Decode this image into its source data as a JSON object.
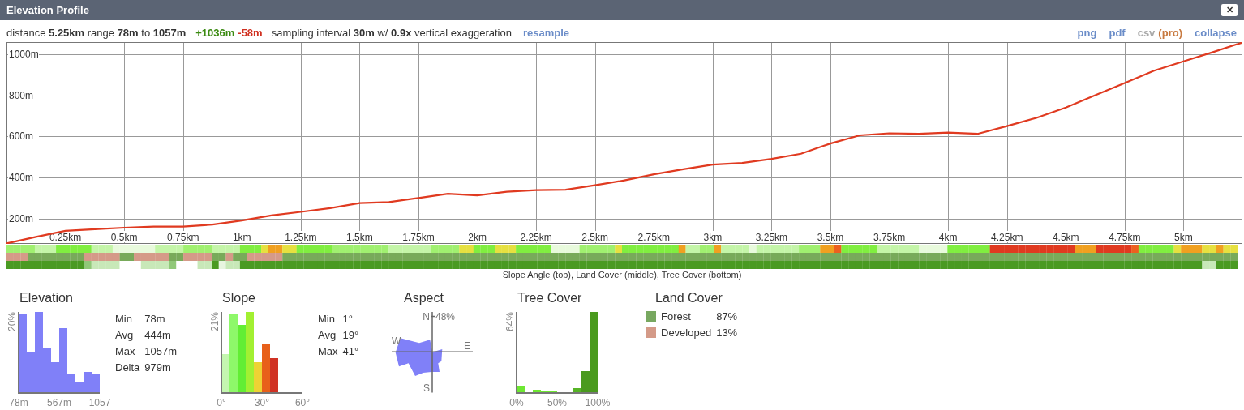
{
  "window": {
    "title": "Elevation Profile",
    "close": "✕"
  },
  "summary": {
    "distance_text": "distance **5.25km** range **78m** to **1057m**",
    "gain": "+1036m",
    "loss": "-58m",
    "sampling_text": "sampling interval **30m** w/ **0.9x** vertical exaggeration",
    "resample": "resample"
  },
  "actions": [
    {
      "label": "png",
      "disabled": false
    },
    {
      "label": "pdf",
      "disabled": false
    },
    {
      "label": "csv",
      "disabled": true,
      "badge": "(pro)"
    },
    {
      "label": "collapse",
      "disabled": false
    }
  ],
  "profile": {
    "chart_data": {
      "type": "line",
      "x": [
        0,
        0.125,
        0.25,
        0.375,
        0.5,
        0.625,
        0.75,
        0.875,
        1,
        1.125,
        1.25,
        1.375,
        1.5,
        1.625,
        1.75,
        1.875,
        2,
        2.125,
        2.25,
        2.375,
        2.5,
        2.625,
        2.75,
        2.875,
        3,
        3.125,
        3.25,
        3.375,
        3.5,
        3.625,
        3.75,
        3.875,
        4,
        4.125,
        4.25,
        4.375,
        4.5,
        4.625,
        4.75,
        4.875,
        5,
        5.125,
        5.25
      ],
      "series": [
        {
          "color": "#e03a20",
          "values": [
            78,
            110,
            140,
            148,
            155,
            160,
            160,
            170,
            190,
            215,
            232,
            250,
            275,
            280,
            300,
            320,
            312,
            330,
            338,
            340,
            362,
            385,
            415,
            440,
            462,
            470,
            490,
            515,
            565,
            605,
            615,
            612,
            618,
            612,
            650,
            690,
            740,
            800,
            860,
            920,
            965,
            1010,
            1057
          ]
        }
      ],
      "xlim": [
        0,
        5.25
      ],
      "ylim": [
        78,
        1057
      ],
      "grid": true,
      "xticks": [
        {
          "value": 0.25,
          "label": "0.25km"
        },
        {
          "value": 0.5,
          "label": "0.5km"
        },
        {
          "value": 0.75,
          "label": "0.75km"
        },
        {
          "value": 1,
          "label": "1km"
        },
        {
          "value": 1.25,
          "label": "1.25km"
        },
        {
          "value": 1.5,
          "label": "1.5km"
        },
        {
          "value": 1.75,
          "label": "1.75km"
        },
        {
          "value": 2,
          "label": "2km"
        },
        {
          "value": 2.25,
          "label": "2.25km"
        },
        {
          "value": 2.5,
          "label": "2.5km"
        },
        {
          "value": 2.75,
          "label": "2.75km"
        },
        {
          "value": 3,
          "label": "3km"
        },
        {
          "value": 3.25,
          "label": "3.25km"
        },
        {
          "value": 3.5,
          "label": "3.5km"
        },
        {
          "value": 3.75,
          "label": "3.75km"
        },
        {
          "value": 4,
          "label": "4km"
        },
        {
          "value": 4.25,
          "label": "4.25km"
        },
        {
          "value": 4.5,
          "label": "4.5km"
        },
        {
          "value": 4.75,
          "label": "4.75km"
        },
        {
          "value": 5,
          "label": "5km"
        }
      ],
      "yticks": [
        {
          "value": 200,
          "label": "200m"
        },
        {
          "value": 400,
          "label": "400m"
        },
        {
          "value": 600,
          "label": "600m"
        },
        {
          "value": 800,
          "label": "800m"
        },
        {
          "value": 1000,
          "label": "1000m"
        }
      ]
    },
    "strip_caption": "Slope Angle (top), Land Cover (middle), Tree Cover (bottom)"
  },
  "panels": [
    {
      "kind": "histogram",
      "title": "Elevation",
      "scale_label": "20%",
      "axis_labels": [
        "78m",
        "567m",
        "1057"
      ],
      "stats": [
        {
          "label": "Min",
          "value": "78m"
        },
        {
          "label": "Avg",
          "value": "444m"
        },
        {
          "label": "Max",
          "value": "1057m"
        },
        {
          "label": "Delta",
          "value": "979m"
        }
      ]
    },
    {
      "kind": "histogram",
      "title": "Slope",
      "scale_label": "21%",
      "axis_labels": [
        "0°",
        "30°",
        "60°"
      ],
      "stats": [
        {
          "label": "Min",
          "value": "1°"
        },
        {
          "label": "Avg",
          "value": "19°"
        },
        {
          "label": "Max",
          "value": "41°"
        }
      ]
    },
    {
      "kind": "rose",
      "title": "Aspect",
      "north": "N",
      "east": "E",
      "south": "S",
      "west": "W",
      "max": "48%"
    },
    {
      "kind": "histogram",
      "title": "Tree Cover",
      "scale_label": "64%",
      "axis_labels": [
        "0%",
        "50%",
        "100%"
      ]
    },
    {
      "kind": "legend",
      "title": "Land Cover",
      "items": [
        {
          "label": "Forest",
          "value": "87%",
          "color": "#78a860"
        },
        {
          "label": "Developed",
          "value": "13%",
          "color": "#d49a88"
        }
      ]
    }
  ]
}
